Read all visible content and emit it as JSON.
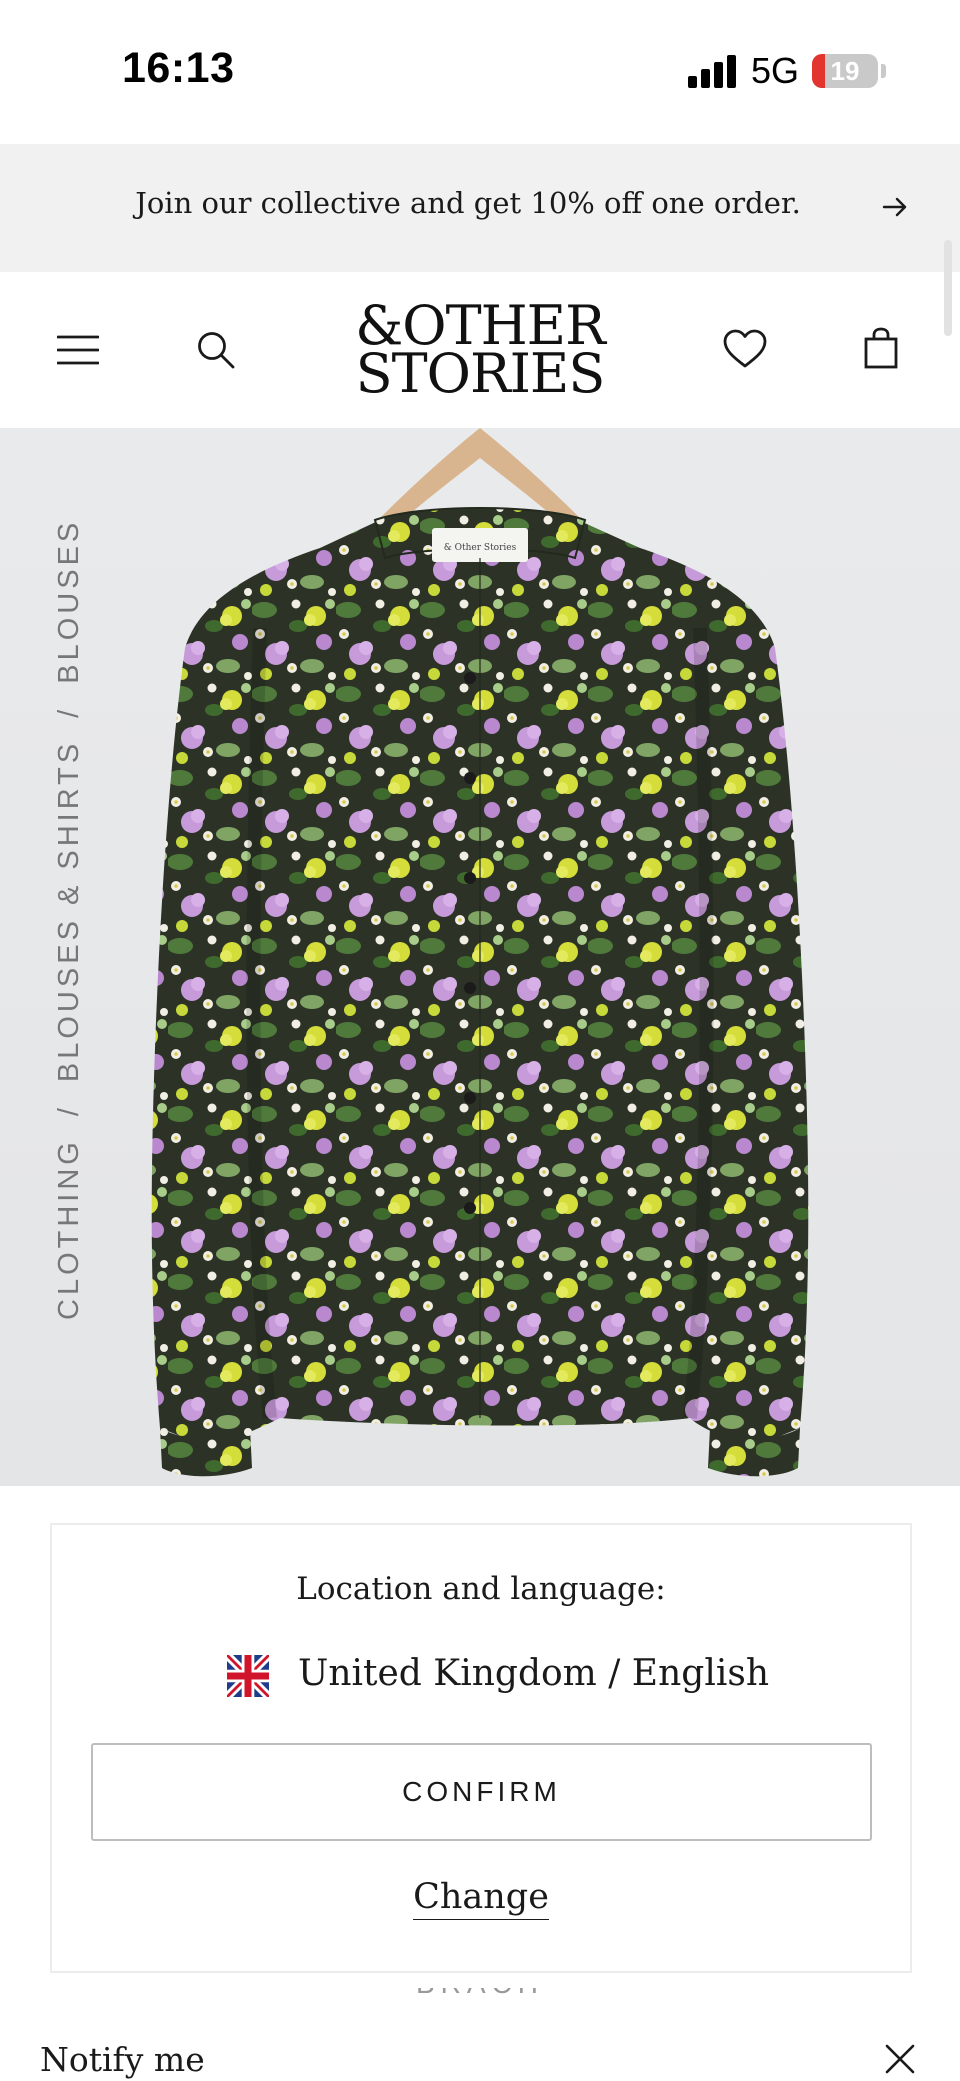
{
  "status_bar": {
    "time": "16:13",
    "network": "5G",
    "battery_level": "19",
    "battery_fraction": 0.19
  },
  "promo": {
    "text": "Join our collective and get 10% off one order.",
    "icon": "arrow-right-icon"
  },
  "header": {
    "logo_line1": "&OTHER",
    "logo_line2": "STORIES",
    "icons": [
      "menu-icon",
      "search-icon",
      "heart-icon",
      "shopping-bag-icon"
    ]
  },
  "breadcrumb": {
    "items": [
      "CLOTHING",
      "BLOUSES & SHIRTS",
      "BLOUSES"
    ],
    "separator": "/"
  },
  "product": {
    "image": "floral-print-blouse-on-hanger",
    "label_text": "& Other Stories"
  },
  "location": {
    "title": "Location and language:",
    "flag_icon": "uk-flag-icon",
    "value": "United Kingdom / English",
    "confirm_label": "CONFIRM",
    "change_label": "Change"
  },
  "footer": {
    "peek_text": "BRACH FLORAL",
    "notify_label": "Notify me",
    "close_icon": "close-icon"
  },
  "colors": {
    "promo_background": "#f1f1f1",
    "product_background": "#e6e7e9",
    "battery_red": "#e3342f"
  }
}
